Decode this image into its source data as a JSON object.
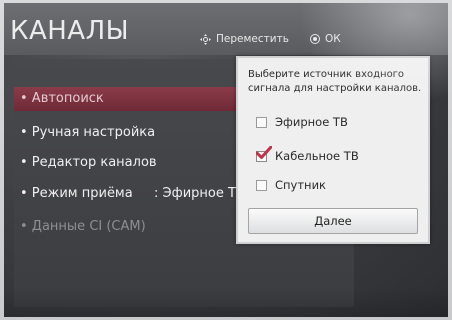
{
  "header": {
    "title": "КАНАЛЫ",
    "hint_move_label": "Переместить",
    "hint_ok_label": "ОК",
    "hint_move_icon": "dpad-icon",
    "hint_ok_icon": "ok-button-icon"
  },
  "menu": {
    "items": [
      {
        "label": "• Автопоиск",
        "state": "selected"
      },
      {
        "label": "• Ручная настройка",
        "state": "normal"
      },
      {
        "label": "• Редактор каналов",
        "state": "normal"
      },
      {
        "label": "• Режим приёма",
        "state": "normal"
      },
      {
        "label": "• Данные CI (CAM)",
        "state": "disabled"
      }
    ],
    "reception_mode_value": ":   Эфирное ТВ"
  },
  "dialog": {
    "message": "Выберите источник входного\nсигнала для настройки каналов.",
    "options": [
      {
        "label": "Эфирное ТВ",
        "checked": false
      },
      {
        "label": "Кабельное ТВ",
        "checked": true
      },
      {
        "label": "Спутник",
        "checked": false
      }
    ],
    "next_button_label": "Далее"
  },
  "colors": {
    "selected_row": "#7a3240",
    "checkmark": "#c2304a",
    "dialog_bg": "#efefef"
  }
}
